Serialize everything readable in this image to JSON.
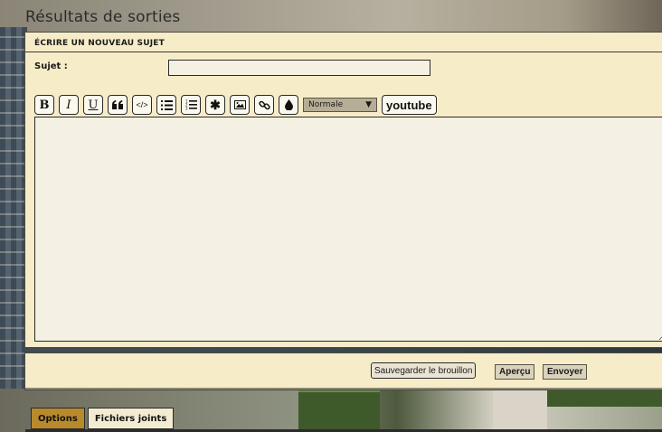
{
  "page": {
    "title": "Résultats de sorties"
  },
  "form": {
    "header": "ÉCRIRE UN NOUVEAU SUJET",
    "subject_label": "Sujet :",
    "subject_value": ""
  },
  "toolbar": {
    "buttons": [
      {
        "name": "bold",
        "glyph": "B"
      },
      {
        "name": "italic",
        "glyph": "I"
      },
      {
        "name": "underline",
        "glyph": "U"
      },
      {
        "name": "quote",
        "glyph": "““"
      },
      {
        "name": "code",
        "glyph": "</>"
      },
      {
        "name": "bullet-list",
        "icon": "list-bullet-icon"
      },
      {
        "name": "numbered-list",
        "icon": "list-numbered-icon"
      },
      {
        "name": "list-item",
        "glyph": "✱"
      },
      {
        "name": "image",
        "icon": "image-icon"
      },
      {
        "name": "link",
        "icon": "link-icon"
      },
      {
        "name": "color",
        "icon": "droplet-icon"
      }
    ],
    "font_size_selected": "Normale",
    "youtube_label": "youtube"
  },
  "actions": {
    "save_draft": "Sauvegarder le brouillon",
    "preview": "Aperçu",
    "submit": "Envoyer"
  },
  "tabs": [
    {
      "label": "Options",
      "active": true
    },
    {
      "label": "Fichiers joints",
      "active": false
    }
  ],
  "colors": {
    "panel_bg": "#f7ecc8",
    "active_tab": "#b98a2c",
    "editor_bg": "#f4f1e4"
  }
}
